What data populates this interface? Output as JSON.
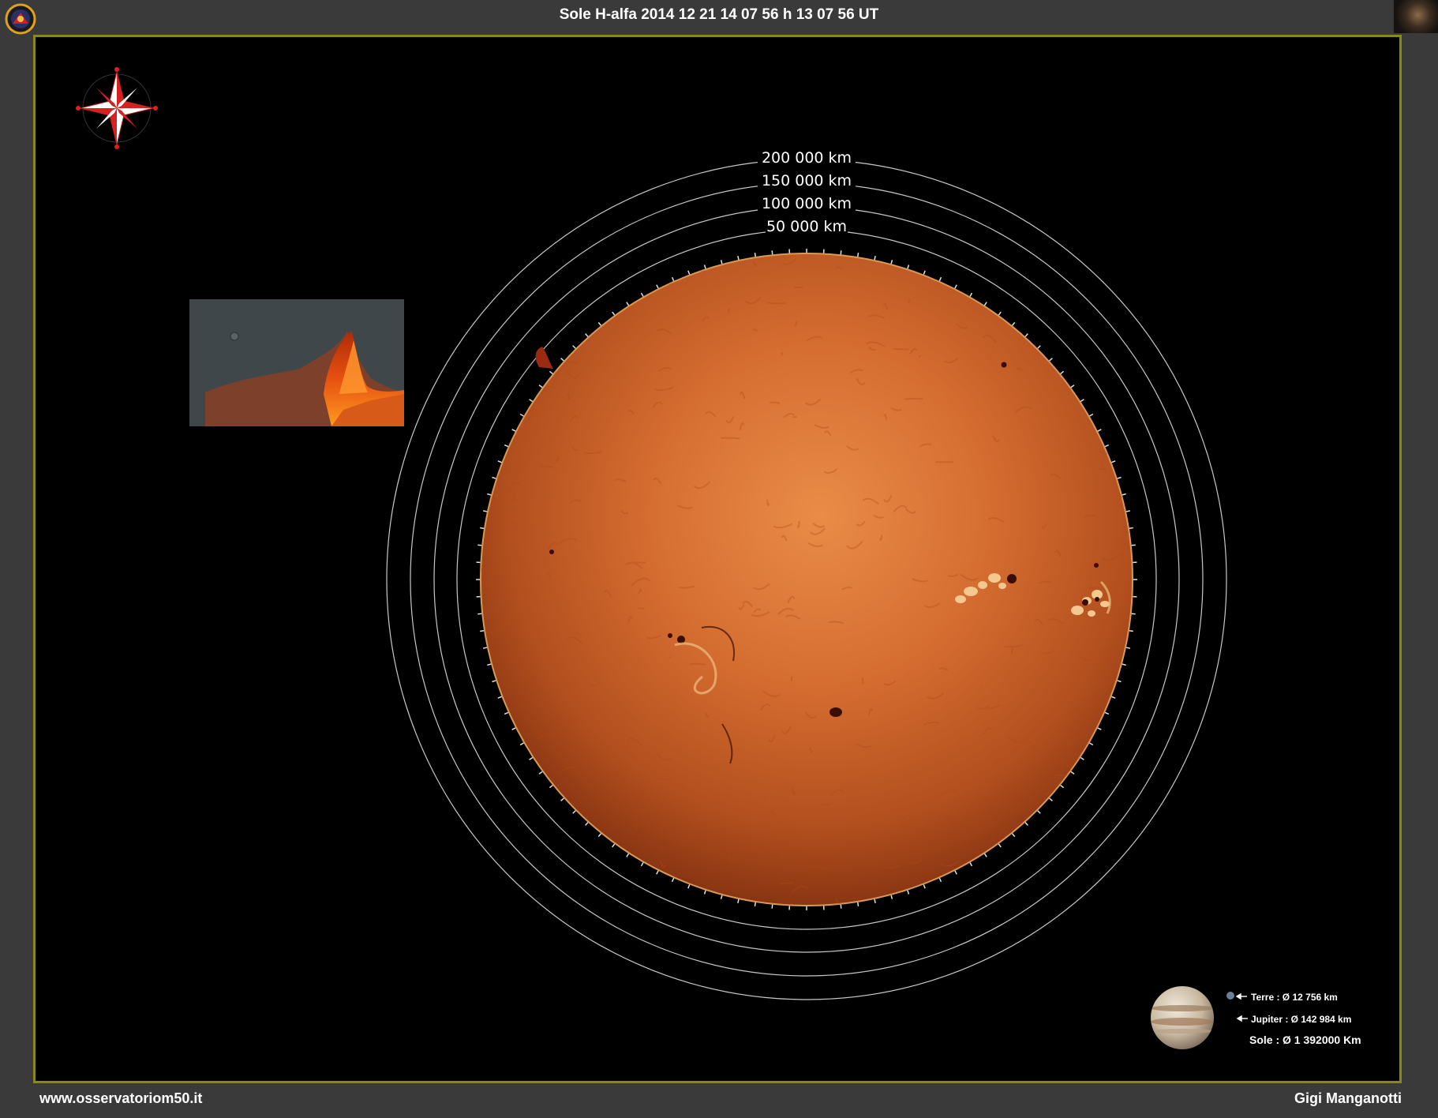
{
  "header": {
    "title": "Sole H-alfa 2014 12 21 14 07 56 h 13 07 56 UT"
  },
  "scale_rings": {
    "labels": [
      "200 000 km",
      "150 000 km",
      "100 000 km",
      "50 000 km"
    ]
  },
  "legend": {
    "earth": "Terre : Ø 12 756 km",
    "jupiter": "Jupiter : Ø 142 984 km",
    "sun": "Sole : Ø 1 392000 Km"
  },
  "footer": {
    "website": "www.osservatoriom50.it",
    "author": "Gigi Manganotti"
  },
  "colors": {
    "frame_border": "#8b8a10",
    "background": "#3a3a3a",
    "sun_center": "#e88a45",
    "sun_edge": "#8c3412"
  },
  "icons": {
    "compass": "compass-rose-icon",
    "logo": "observatory-logo-icon"
  }
}
